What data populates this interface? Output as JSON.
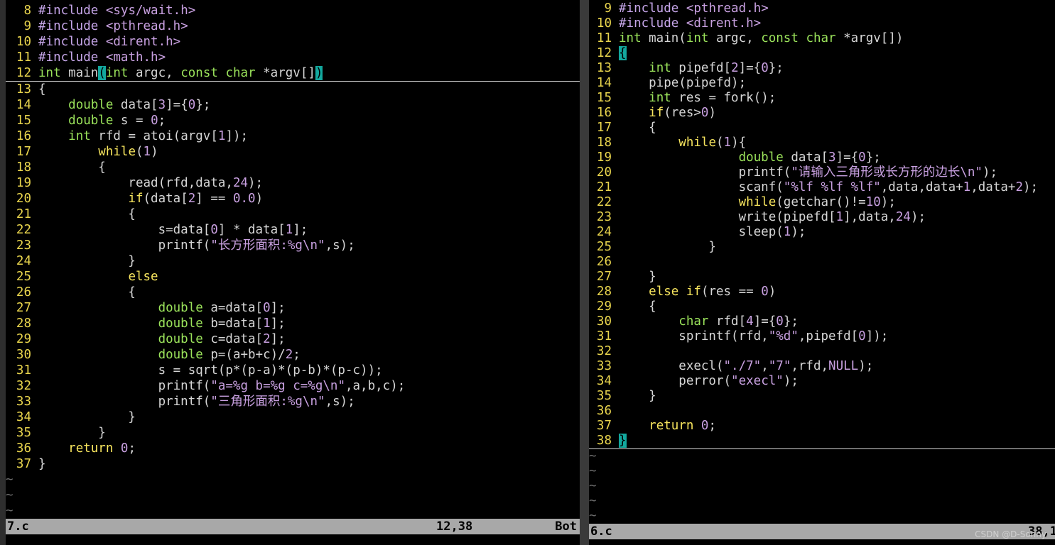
{
  "left": {
    "filename": "7.c",
    "position": "12,38",
    "percent": "Bot",
    "lines": [
      {
        "n": "8",
        "text": "#include <sys/wait.h>"
      },
      {
        "n": "9",
        "text": "#include <pthread.h>"
      },
      {
        "n": "10",
        "text": "#include <dirent.h>"
      },
      {
        "n": "11",
        "text": "#include <math.h>"
      },
      {
        "n": "12",
        "text": "int main(int argc, const char *argv[])",
        "cursor": true
      },
      {
        "n": "13",
        "text": "{"
      },
      {
        "n": "14",
        "text": "    double data[3]={0};"
      },
      {
        "n": "15",
        "text": "    double s = 0;"
      },
      {
        "n": "16",
        "text": "    int rfd = atoi(argv[1]);"
      },
      {
        "n": "17",
        "text": "        while(1)"
      },
      {
        "n": "18",
        "text": "        {"
      },
      {
        "n": "19",
        "text": "            read(rfd,data,24);"
      },
      {
        "n": "20",
        "text": "            if(data[2] == 0.0)"
      },
      {
        "n": "21",
        "text": "            {"
      },
      {
        "n": "22",
        "text": "                s=data[0] * data[1];"
      },
      {
        "n": "23",
        "text": "                printf(\"长方形面积:%g\\n\",s);"
      },
      {
        "n": "24",
        "text": "            }"
      },
      {
        "n": "25",
        "text": "            else"
      },
      {
        "n": "26",
        "text": "            {"
      },
      {
        "n": "27",
        "text": "                double a=data[0];"
      },
      {
        "n": "28",
        "text": "                double b=data[1];"
      },
      {
        "n": "29",
        "text": "                double c=data[2];"
      },
      {
        "n": "30",
        "text": "                double p=(a+b+c)/2;"
      },
      {
        "n": "31",
        "text": "                s = sqrt(p*(p-a)*(p-b)*(p-c));"
      },
      {
        "n": "32",
        "text": "                printf(\"a=%g b=%g c=%g\\n\",a,b,c);"
      },
      {
        "n": "33",
        "text": "                printf(\"三角形面积:%g\\n\",s);"
      },
      {
        "n": "34",
        "text": "            }"
      },
      {
        "n": "35",
        "text": "        }"
      },
      {
        "n": "36",
        "text": "    return 0;"
      },
      {
        "n": "37",
        "text": "}"
      }
    ],
    "tildes": 3
  },
  "right": {
    "filename": "6.c",
    "position": "38,1",
    "lines": [
      {
        "n": "9",
        "text": "#include <pthread.h>"
      },
      {
        "n": "10",
        "text": "#include <dirent.h>"
      },
      {
        "n": "11",
        "text": "int main(int argc, const char *argv[])"
      },
      {
        "n": "12",
        "text": "{",
        "hlbrace": true
      },
      {
        "n": "13",
        "text": "    int pipefd[2]={0};"
      },
      {
        "n": "14",
        "text": "    pipe(pipefd);"
      },
      {
        "n": "15",
        "text": "    int res = fork();"
      },
      {
        "n": "16",
        "text": "    if(res>0)"
      },
      {
        "n": "17",
        "text": "    {"
      },
      {
        "n": "18",
        "text": "        while(1){"
      },
      {
        "n": "19",
        "text": "                double data[3]={0};"
      },
      {
        "n": "20",
        "text": "                printf(\"请输入三角形或长方形的边长\\n\");"
      },
      {
        "n": "21",
        "text": "                scanf(\"%lf %lf %lf\",data,data+1,data+2);"
      },
      {
        "n": "22",
        "text": "                while(getchar()!=10);"
      },
      {
        "n": "23",
        "text": "                write(pipefd[1],data,24);"
      },
      {
        "n": "24",
        "text": "                sleep(1);"
      },
      {
        "n": "25",
        "text": "            }"
      },
      {
        "n": "26",
        "text": ""
      },
      {
        "n": "27",
        "text": "    }"
      },
      {
        "n": "28",
        "text": "    else if(res == 0)"
      },
      {
        "n": "29",
        "text": "    {"
      },
      {
        "n": "30",
        "text": "        char rfd[4]={0};"
      },
      {
        "n": "31",
        "text": "        sprintf(rfd,\"%d\",pipefd[0]);"
      },
      {
        "n": "32",
        "text": ""
      },
      {
        "n": "33",
        "text": "        execl(\"./7\",\"7\",rfd,NULL);"
      },
      {
        "n": "34",
        "text": "        perror(\"execl\");"
      },
      {
        "n": "35",
        "text": "    }"
      },
      {
        "n": "36",
        "text": ""
      },
      {
        "n": "37",
        "text": "    return 0;"
      },
      {
        "n": "38",
        "text": "}",
        "hlbrace": true,
        "cursor": true
      }
    ],
    "tildes": 5
  },
  "watermark": "CSDN @D-Sonny",
  "colors": {
    "linenumber": "#e8d44d",
    "keyword": "#f7e55e",
    "type": "#9be35b",
    "string": "#c8a0e0",
    "status": "#a8a8a8",
    "match_paren": "#13a89e"
  }
}
